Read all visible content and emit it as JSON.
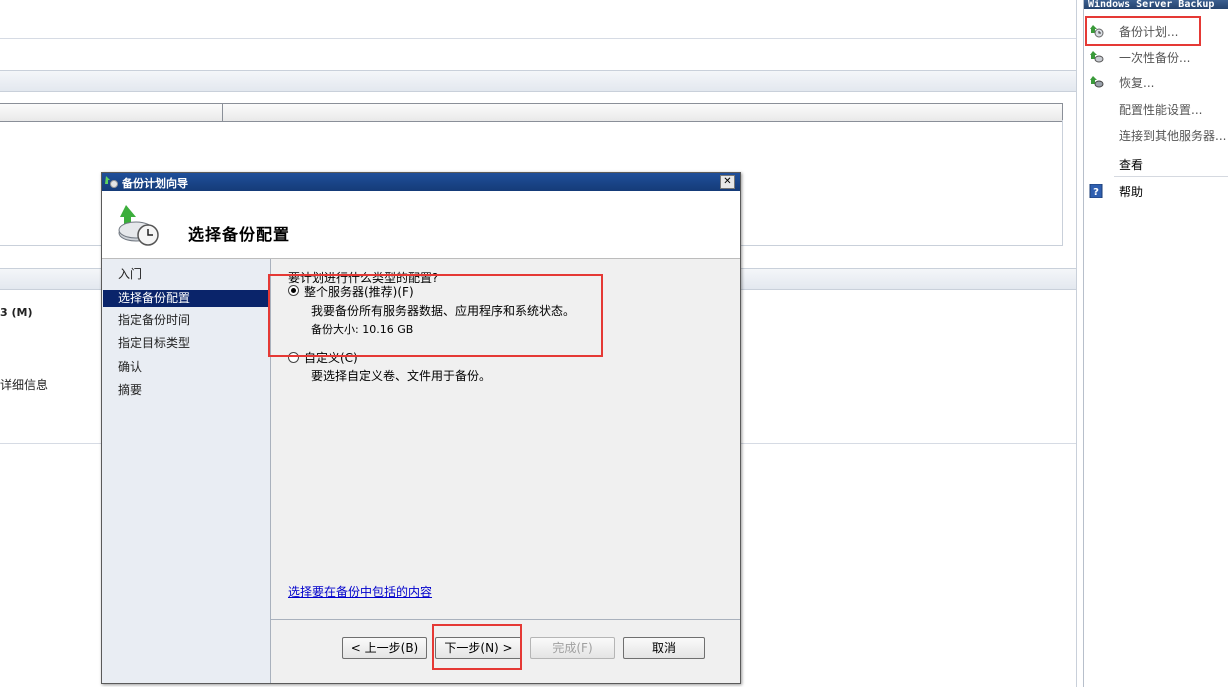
{
  "actions": {
    "title": "Windows Server Backup",
    "items": [
      {
        "label": "备份计划...",
        "icon": "backup-schedule-icon"
      },
      {
        "label": "一次性备份...",
        "icon": "backup-once-icon"
      },
      {
        "label": "恢复...",
        "icon": "recover-icon"
      },
      {
        "label": "配置性能设置...",
        "icon": ""
      },
      {
        "label": "连接到其他服务器...",
        "icon": ""
      },
      {
        "label": "查看",
        "icon": ""
      },
      {
        "label": "帮助",
        "icon": "help-icon"
      }
    ]
  },
  "background": {
    "status_text_1": "3 (M)",
    "status_text_2": "详细信息"
  },
  "dialog": {
    "title": "备份计划向导",
    "close_label": "✕",
    "header_title": "选择备份配置",
    "steps": [
      "入门",
      "选择备份配置",
      "指定备份时间",
      "指定目标类型",
      "确认",
      "摘要"
    ],
    "active_step": 1,
    "question": "要计划进行什么类型的配置?",
    "option_full_label": "整个服务器(推荐)(F)",
    "option_full_desc": "我要备份所有服务器数据、应用程序和系统状态。",
    "backup_size": "备份大小: 10.16 GB",
    "option_custom_label": "自定义(C)",
    "option_custom_desc": "要选择自定义卷、文件用于备份。",
    "link_text": "选择要在备份中包括的内容",
    "buttons": {
      "back": "< 上一步(B)",
      "next": "下一步(N) >",
      "finish": "完成(F)",
      "cancel": "取消"
    }
  },
  "colors": {
    "highlight": "#e53935",
    "active_step_bg": "#0a246a",
    "titlebar": "#1f4f9a"
  }
}
